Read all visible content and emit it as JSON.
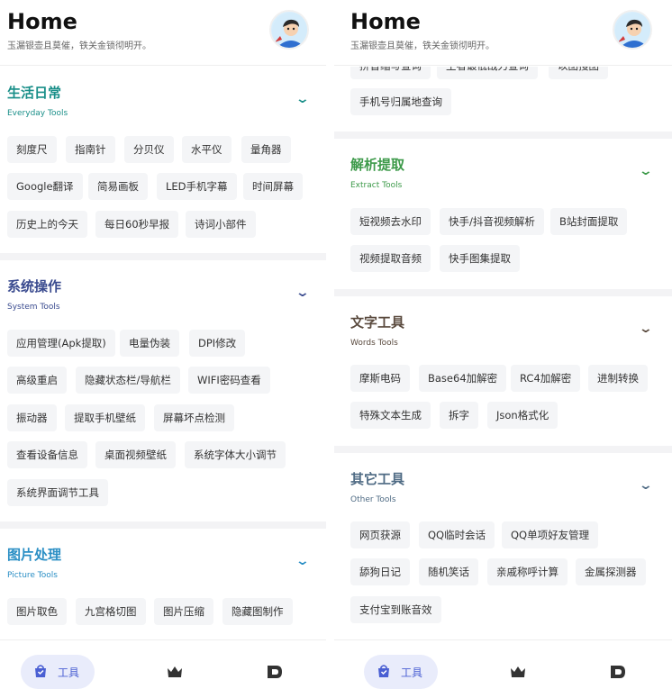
{
  "left_screen": {
    "header": {
      "title": "Home",
      "subtitle": "玉漏银壶且莫催，铁关金锁彻明开。"
    },
    "sections": [
      {
        "title": "生活日常",
        "subtitle": "Everyday Tools",
        "color": "#1a8f89",
        "items": [
          "刻度尺",
          "指南针",
          "分贝仪",
          "水平仪",
          "量角器",
          "Google翻译",
          "简易画板",
          "LED手机字幕",
          "时间屏幕",
          "历史上的今天",
          "每日60秒早报",
          "诗词小部件"
        ]
      },
      {
        "title": "系统操作",
        "subtitle": "System Tools",
        "color": "#3a4b8f",
        "items": [
          "应用管理(Apk提取)",
          "电量伪装",
          "DPI修改",
          "高级重启",
          "隐藏状态栏/导航栏",
          "WIFI密码查看",
          "振动器",
          "提取手机壁纸",
          "屏幕坏点检测",
          "查看设备信息",
          "桌面视频壁纸",
          "系统字体大小调节",
          "系统界面调节工具"
        ]
      },
      {
        "title": "图片处理",
        "subtitle": "Picture Tools",
        "color": "#2b8fc5",
        "items": [
          "图片取色",
          "九宫格切图",
          "图片压缩",
          "隐藏图制作"
        ]
      }
    ],
    "tabbar": {
      "active_label": "工具"
    }
  },
  "right_screen": {
    "header": {
      "title": "Home",
      "subtitle": "玉漏银壶且莫催，铁关金锁彻明开。"
    },
    "partial_items": [
      "拼音缩写查询",
      "王者最低战力查询",
      "以图搜图",
      "手机号归属地查询"
    ],
    "sections": [
      {
        "title": "解析提取",
        "subtitle": "Extract Tools",
        "color": "#3d9a4a",
        "items": [
          "短视频去水印",
          "快手/抖音视频解析",
          "B站封面提取",
          "视频提取音频",
          "快手图集提取"
        ]
      },
      {
        "title": "文字工具",
        "subtitle": "Words Tools",
        "color": "#5a4a3e",
        "items": [
          "摩斯电码",
          "Base64加解密",
          "RC4加解密",
          "进制转换",
          "特殊文本生成",
          "拆字",
          "Json格式化"
        ]
      },
      {
        "title": "其它工具",
        "subtitle": "Other Tools",
        "color": "#4f6b84",
        "items": [
          "网页获源",
          "QQ临时会话",
          "QQ单项好友管理",
          "舔狗日记",
          "随机笑话",
          "亲戚称呼计算",
          "金属探测器",
          "支付宝到账音效"
        ]
      }
    ],
    "tabbar": {
      "active_label": "工具"
    }
  }
}
